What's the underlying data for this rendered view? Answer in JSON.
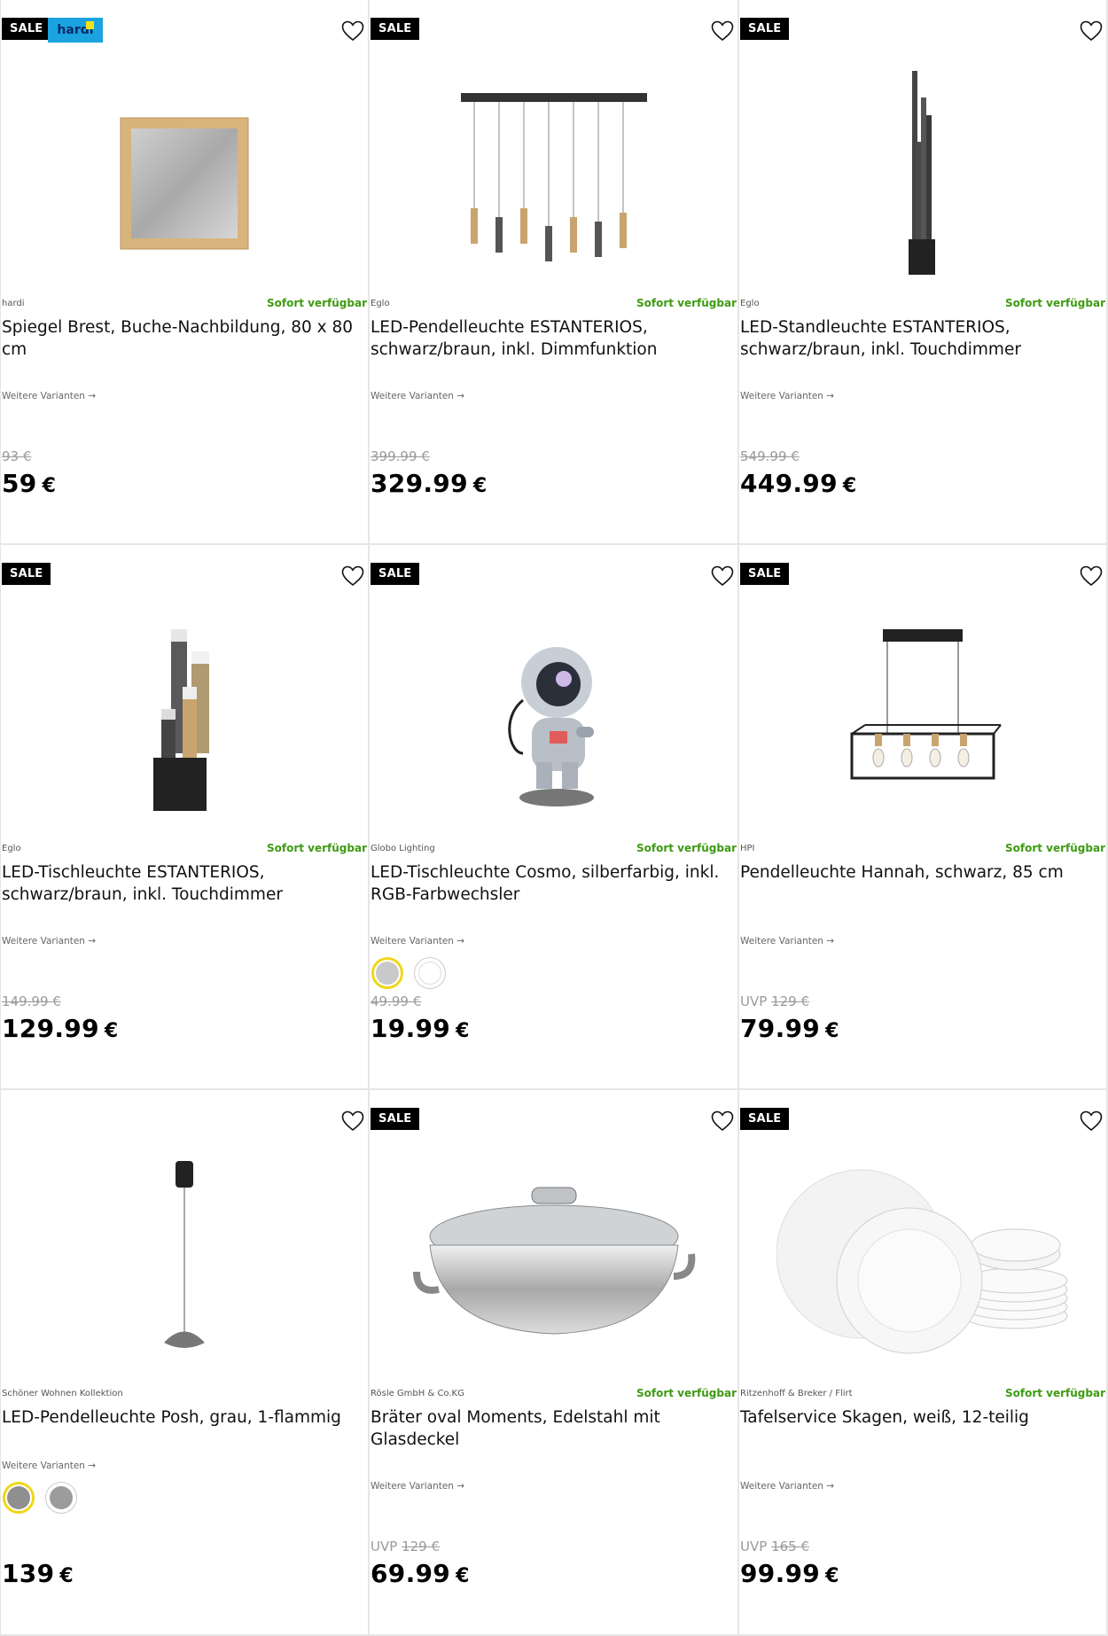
{
  "products": [
    {
      "sale": "SALE",
      "brand_logo": "hardi",
      "brand": "hardi",
      "availability": "Sofort verfügbar",
      "title": "Spiegel Brest, Buche-Nachbildung, 80 x 80 cm",
      "variants_link": "Weitere Varianten →",
      "uvp": "",
      "old_price": "93 €",
      "price": "59",
      "currency": "€",
      "image": "mirror"
    },
    {
      "sale": "SALE",
      "brand": "Eglo",
      "availability": "Sofort verfügbar",
      "title": "LED-Pendelleuchte ESTANTERIOS, schwarz/braun, inkl. Dimmfunktion",
      "variants_link": "Weitere Varianten →",
      "uvp": "",
      "old_price": "399.99 €",
      "price": "329.99",
      "currency": "€",
      "image": "pendant-multi"
    },
    {
      "sale": "SALE",
      "brand": "Eglo",
      "availability": "Sofort verfügbar",
      "title": "LED-Standleuchte ESTANTERIOS, schwarz/braun, inkl. Touchdimmer",
      "variants_link": "Weitere Varianten →",
      "uvp": "",
      "old_price": "549.99 €",
      "price": "449.99",
      "currency": "€",
      "image": "floor-lamp"
    },
    {
      "sale": "SALE",
      "brand": "Eglo",
      "availability": "Sofort verfügbar",
      "title": "LED-Tischleuchte ESTANTERIOS, schwarz/braun, inkl. Touchdimmer",
      "variants_link": "Weitere Varianten →",
      "uvp": "",
      "old_price": "149.99 €",
      "price": "129.99",
      "currency": "€",
      "image": "table-lamp"
    },
    {
      "sale": "SALE",
      "brand": "Globo Lighting",
      "availability": "Sofort verfügbar",
      "title": "LED-Tischleuchte Cosmo, silberfarbig, inkl. RGB-Farbwechsler",
      "variants_link": "Weitere Varianten →",
      "swatches": [
        {
          "color": "#c9c9c9",
          "selected": true
        },
        {
          "color": "#ffffff",
          "selected": false
        }
      ],
      "uvp": "",
      "old_price": "49.99 €",
      "price": "19.99",
      "currency": "€",
      "image": "astronaut"
    },
    {
      "sale": "SALE",
      "brand": "HPI",
      "availability": "Sofort verfügbar",
      "title": "Pendelleuchte Hannah, schwarz, 85 cm",
      "variants_link": "Weitere Varianten →",
      "uvp": "UVP",
      "old_price": "129 €",
      "price": "79.99",
      "currency": "€",
      "image": "pendant-cage"
    },
    {
      "sale": "",
      "brand": "Schöner Wohnen Kollektion",
      "availability": "",
      "title": "LED-Pendelleuchte Posh, grau, 1-flammig",
      "variants_link": "Weitere Varianten →",
      "swatches": [
        {
          "color": "#8f8f8f",
          "selected": true
        },
        {
          "color": "#9c9c9c",
          "selected": false
        }
      ],
      "uvp": "",
      "old_price": "",
      "price": "139",
      "currency": "€",
      "image": "pendant-single"
    },
    {
      "sale": "SALE",
      "brand": "Rösle GmbH & Co.KG",
      "availability": "Sofort verfügbar",
      "title": "Bräter oval Moments, Edelstahl mit Glasdeckel",
      "variants_link": "Weitere Varianten →",
      "uvp": "UVP",
      "old_price": "129 €",
      "price": "69.99",
      "currency": "€",
      "image": "roaster"
    },
    {
      "sale": "SALE",
      "brand": "Ritzenhoff & Breker / Flirt",
      "availability": "Sofort verfügbar",
      "title": "Tafelservice Skagen, weiß, 12-teilig",
      "variants_link": "Weitere Varianten →",
      "uvp": "UVP",
      "old_price": "165 €",
      "price": "99.99",
      "currency": "€",
      "image": "dinnerware"
    }
  ],
  "colors": {
    "availability": "#3e9a12",
    "sale_badge": "#000000",
    "swatch_selected": "#f0d718"
  }
}
